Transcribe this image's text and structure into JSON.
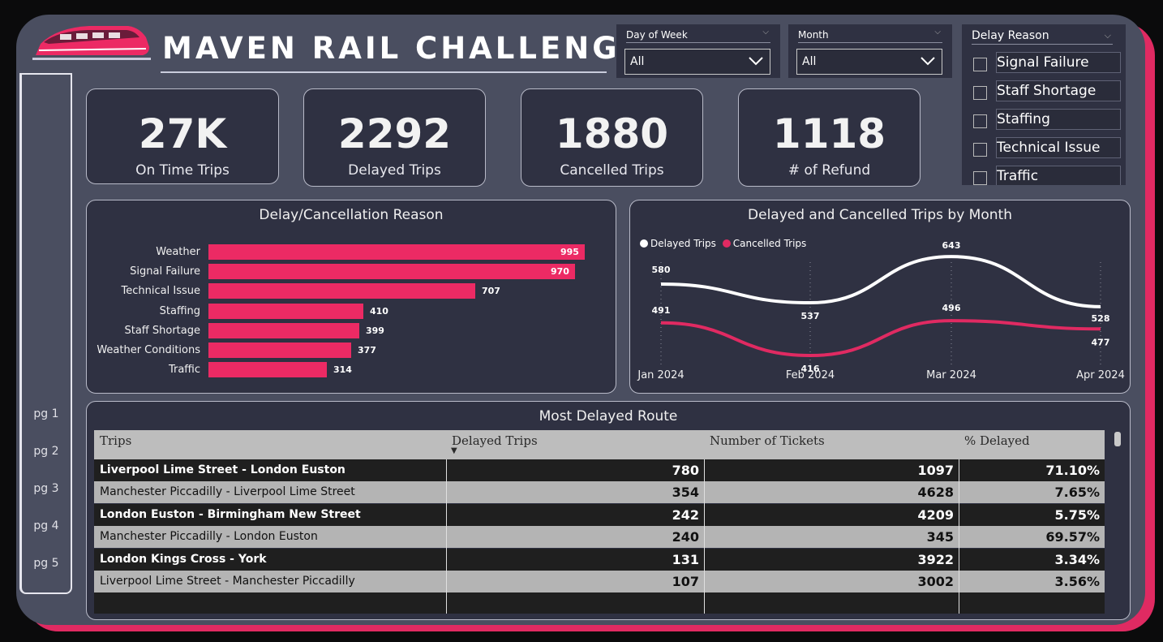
{
  "header": {
    "title": "MAVEN RAIL CHALLENGE"
  },
  "filters": {
    "day_of_week": {
      "label": "Day of Week",
      "value": "All"
    },
    "month": {
      "label": "Month",
      "value": "All"
    },
    "delay_reason": {
      "label": "Delay Reason",
      "options": [
        "Signal Failure",
        "Staff Shortage",
        "Staffing",
        "Technical Issue",
        "Traffic"
      ]
    }
  },
  "nav": {
    "pages": [
      "pg 1",
      "pg 2",
      "pg 3",
      "pg 4",
      "pg 5"
    ]
  },
  "kpis": [
    {
      "value": "27K",
      "label": "On Time Trips"
    },
    {
      "value": "2292",
      "label": "Delayed Trips"
    },
    {
      "value": "1880",
      "label": "Cancelled Trips"
    },
    {
      "value": "1118",
      "label": "# of Refund"
    }
  ],
  "colors": {
    "accent": "#ec2a64",
    "panel": "#2f3142",
    "background": "#4a4e60",
    "line_delayed": "#ffffff",
    "line_cancelled": "#e02a62"
  },
  "chart_data": [
    {
      "type": "bar",
      "title": "Delay/Cancellation Reason",
      "categories": [
        "Weather",
        "Signal Failure",
        "Technical Issue",
        "Staffing",
        "Staff Shortage",
        "Weather Conditions",
        "Traffic"
      ],
      "values": [
        995,
        970,
        707,
        410,
        399,
        377,
        314
      ],
      "orientation": "horizontal",
      "xlim": [
        0,
        1000
      ]
    },
    {
      "type": "line",
      "title": "Delayed and Cancelled Trips by Month",
      "x": [
        "Jan 2024",
        "Feb 2024",
        "Mar 2024",
        "Apr 2024"
      ],
      "series": [
        {
          "name": "Delayed Trips",
          "values": [
            580,
            537,
            643,
            528
          ],
          "color": "#ffffff"
        },
        {
          "name": "Cancelled Trips",
          "values": [
            491,
            416,
            496,
            477
          ],
          "color": "#e02a62"
        }
      ],
      "legend": "top-left",
      "grid": false
    }
  ],
  "table": {
    "title": "Most Delayed Route",
    "columns": [
      "Trips",
      "Delayed Trips",
      "Number of Tickets",
      "% Delayed"
    ],
    "sort_indicator": "▼",
    "rows": [
      [
        "Liverpool Lime Street - London Euston",
        "780",
        "1097",
        "71.10%"
      ],
      [
        "Manchester Piccadilly - Liverpool Lime Street",
        "354",
        "4628",
        "7.65%"
      ],
      [
        "London Euston - Birmingham New Street",
        "242",
        "4209",
        "5.75%"
      ],
      [
        "Manchester Piccadilly - London Euston",
        "240",
        "345",
        "69.57%"
      ],
      [
        "London Kings Cross - York",
        "131",
        "3922",
        "3.34%"
      ],
      [
        "Liverpool Lime Street - Manchester Piccadilly",
        "107",
        "3002",
        "3.56%"
      ]
    ]
  }
}
